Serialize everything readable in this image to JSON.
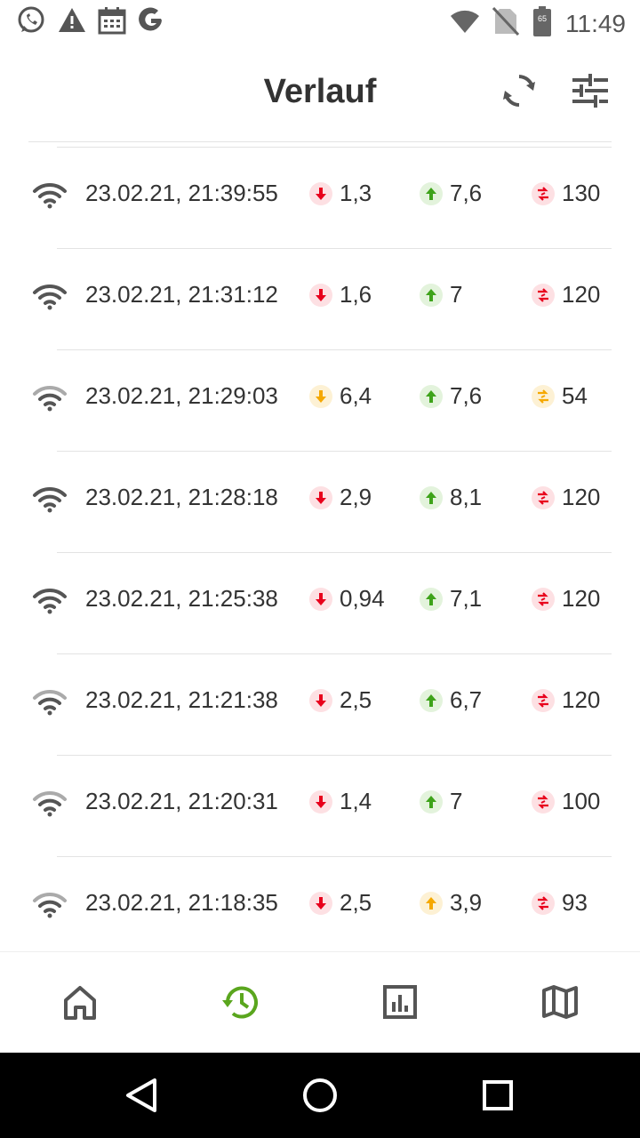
{
  "status_bar": {
    "time": "11:49",
    "battery_level": "65",
    "icons_left": [
      "whatsapp-icon",
      "warning-icon",
      "calendar-icon",
      "google-icon"
    ],
    "icons_right": [
      "wifi-signal-icon",
      "no-sim-icon",
      "battery-icon"
    ]
  },
  "header": {
    "title": "Verlauf",
    "actions": [
      "refresh-icon",
      "filter-sliders-icon"
    ]
  },
  "colors": {
    "red": "#e8001c",
    "red_bg": "#fde0e3",
    "green": "#3ea31a",
    "green_bg": "#e3f3dc",
    "orange": "#f5a800",
    "orange_bg": "#fdf1d4",
    "accent": "#5aa61e"
  },
  "history": [
    {
      "timestamp": "23.02.21, 21:39:55",
      "wifi_strength": "strong",
      "download": "1,3",
      "download_status": "red",
      "upload": "7,6",
      "upload_status": "green",
      "ping": "130",
      "ping_status": "red"
    },
    {
      "timestamp": "23.02.21, 21:31:12",
      "wifi_strength": "strong",
      "download": "1,6",
      "download_status": "red",
      "upload": "7",
      "upload_status": "green",
      "ping": "120",
      "ping_status": "red"
    },
    {
      "timestamp": "23.02.21, 21:29:03",
      "wifi_strength": "weak",
      "download": "6,4",
      "download_status": "orange",
      "upload": "7,6",
      "upload_status": "green",
      "ping": "54",
      "ping_status": "orange"
    },
    {
      "timestamp": "23.02.21, 21:28:18",
      "wifi_strength": "strong",
      "download": "2,9",
      "download_status": "red",
      "upload": "8,1",
      "upload_status": "green",
      "ping": "120",
      "ping_status": "red"
    },
    {
      "timestamp": "23.02.21, 21:25:38",
      "wifi_strength": "strong",
      "download": "0,94",
      "download_status": "red",
      "upload": "7,1",
      "upload_status": "green",
      "ping": "120",
      "ping_status": "red"
    },
    {
      "timestamp": "23.02.21, 21:21:38",
      "wifi_strength": "weak",
      "download": "2,5",
      "download_status": "red",
      "upload": "6,7",
      "upload_status": "green",
      "ping": "120",
      "ping_status": "red"
    },
    {
      "timestamp": "23.02.21, 21:20:31",
      "wifi_strength": "weak",
      "download": "1,4",
      "download_status": "red",
      "upload": "7",
      "upload_status": "green",
      "ping": "100",
      "ping_status": "red"
    },
    {
      "timestamp": "23.02.21, 21:18:35",
      "wifi_strength": "weak",
      "download": "2,5",
      "download_status": "red",
      "upload": "3,9",
      "upload_status": "orange",
      "ping": "93",
      "ping_status": "red"
    }
  ],
  "bottom_nav": {
    "items": [
      "home-icon",
      "history-icon",
      "statistics-icon",
      "map-icon"
    ],
    "active": "history-icon"
  },
  "system_nav": [
    "back-icon",
    "home-circle-icon",
    "recents-icon"
  ]
}
